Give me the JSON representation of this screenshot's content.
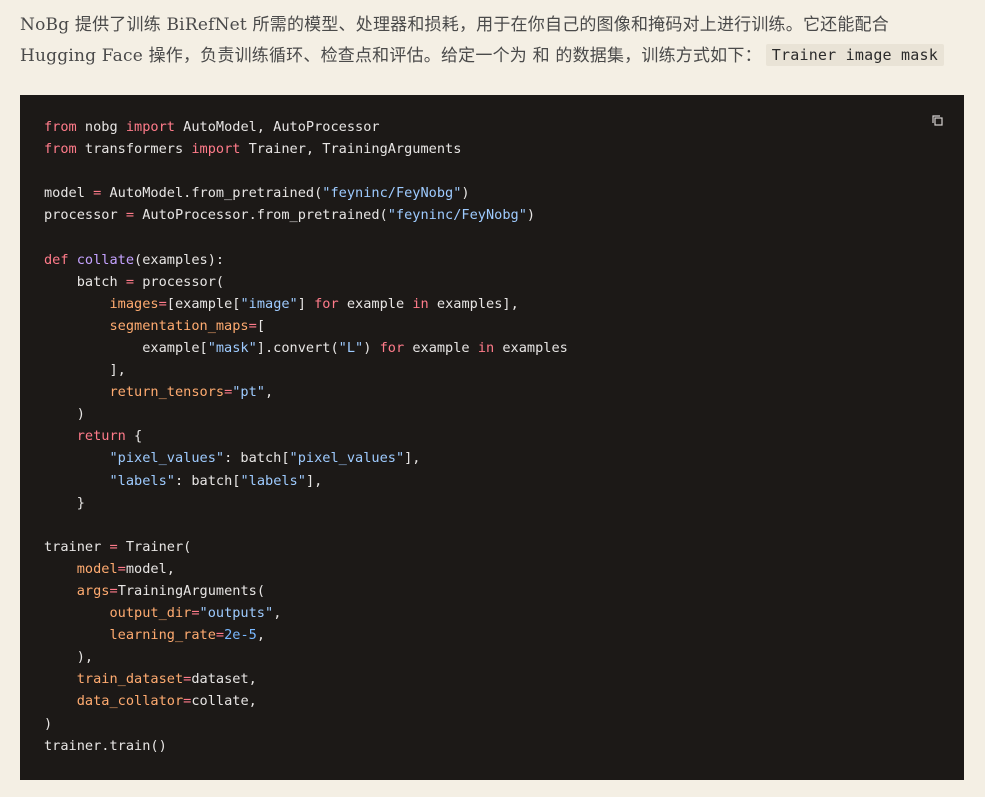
{
  "intro": {
    "line1": "NoBg 提供了训练 BiRefNet 所需的模型、处理器和损耗，用于在你自己的图像和掩码对上进行训练。它还能配合",
    "line2": "Hugging Face 操作，负责训练循环、检查点和评估。给定一个为 和 的数据集，训练方式如下：",
    "inline_code": "Trainer image mask"
  },
  "code_block": {
    "language": "python",
    "copy_icon": "copy-icon",
    "lines": [
      [
        [
          "kw",
          "from"
        ],
        [
          "plain",
          " nobg "
        ],
        [
          "kw",
          "import"
        ],
        [
          "plain",
          " AutoModel, AutoProcessor"
        ]
      ],
      [
        [
          "kw",
          "from"
        ],
        [
          "plain",
          " transformers "
        ],
        [
          "kw",
          "import"
        ],
        [
          "plain",
          " Trainer, TrainingArguments"
        ]
      ],
      [],
      [
        [
          "plain",
          "model "
        ],
        [
          "op",
          "="
        ],
        [
          "plain",
          " AutoModel.from_pretrained("
        ],
        [
          "str",
          "\"feyninc/FeyNobg\""
        ],
        [
          "plain",
          ")"
        ]
      ],
      [
        [
          "plain",
          "processor "
        ],
        [
          "op",
          "="
        ],
        [
          "plain",
          " AutoProcessor.from_pretrained("
        ],
        [
          "str",
          "\"feyninc/FeyNobg\""
        ],
        [
          "plain",
          ")"
        ]
      ],
      [],
      [
        [
          "kw",
          "def"
        ],
        [
          "plain",
          " "
        ],
        [
          "fn",
          "collate"
        ],
        [
          "plain",
          "(examples):"
        ]
      ],
      [
        [
          "plain",
          "    batch "
        ],
        [
          "op",
          "="
        ],
        [
          "plain",
          " processor("
        ]
      ],
      [
        [
          "plain",
          "        "
        ],
        [
          "param",
          "images"
        ],
        [
          "op",
          "="
        ],
        [
          "plain",
          "[example["
        ],
        [
          "str",
          "\"image\""
        ],
        [
          "plain",
          "] "
        ],
        [
          "kw",
          "for"
        ],
        [
          "plain",
          " example "
        ],
        [
          "kw",
          "in"
        ],
        [
          "plain",
          " examples],"
        ]
      ],
      [
        [
          "plain",
          "        "
        ],
        [
          "param",
          "segmentation_maps"
        ],
        [
          "op",
          "="
        ],
        [
          "plain",
          "["
        ]
      ],
      [
        [
          "plain",
          "            example["
        ],
        [
          "str",
          "\"mask\""
        ],
        [
          "plain",
          "].convert("
        ],
        [
          "str",
          "\"L\""
        ],
        [
          "plain",
          ") "
        ],
        [
          "kw",
          "for"
        ],
        [
          "plain",
          " example "
        ],
        [
          "kw",
          "in"
        ],
        [
          "plain",
          " examples"
        ]
      ],
      [
        [
          "plain",
          "        ],"
        ]
      ],
      [
        [
          "plain",
          "        "
        ],
        [
          "param",
          "return_tensors"
        ],
        [
          "op",
          "="
        ],
        [
          "str",
          "\"pt\""
        ],
        [
          "plain",
          ","
        ]
      ],
      [
        [
          "plain",
          "    )"
        ]
      ],
      [
        [
          "plain",
          "    "
        ],
        [
          "kw",
          "return"
        ],
        [
          "plain",
          " {"
        ]
      ],
      [
        [
          "plain",
          "        "
        ],
        [
          "str",
          "\"pixel_values\""
        ],
        [
          "plain",
          ": batch["
        ],
        [
          "str",
          "\"pixel_values\""
        ],
        [
          "plain",
          "],"
        ]
      ],
      [
        [
          "plain",
          "        "
        ],
        [
          "str",
          "\"labels\""
        ],
        [
          "plain",
          ": batch["
        ],
        [
          "str",
          "\"labels\""
        ],
        [
          "plain",
          "],"
        ]
      ],
      [
        [
          "plain",
          "    }"
        ]
      ],
      [],
      [
        [
          "plain",
          "trainer "
        ],
        [
          "op",
          "="
        ],
        [
          "plain",
          " Trainer("
        ]
      ],
      [
        [
          "plain",
          "    "
        ],
        [
          "param",
          "model"
        ],
        [
          "op",
          "="
        ],
        [
          "plain",
          "model,"
        ]
      ],
      [
        [
          "plain",
          "    "
        ],
        [
          "param",
          "args"
        ],
        [
          "op",
          "="
        ],
        [
          "plain",
          "TrainingArguments("
        ]
      ],
      [
        [
          "plain",
          "        "
        ],
        [
          "param",
          "output_dir"
        ],
        [
          "op",
          "="
        ],
        [
          "str",
          "\"outputs\""
        ],
        [
          "plain",
          ","
        ]
      ],
      [
        [
          "plain",
          "        "
        ],
        [
          "param",
          "learning_rate"
        ],
        [
          "op",
          "="
        ],
        [
          "num",
          "2e-5"
        ],
        [
          "plain",
          ","
        ]
      ],
      [
        [
          "plain",
          "    ),"
        ]
      ],
      [
        [
          "plain",
          "    "
        ],
        [
          "param",
          "train_dataset"
        ],
        [
          "op",
          "="
        ],
        [
          "plain",
          "dataset,"
        ]
      ],
      [
        [
          "plain",
          "    "
        ],
        [
          "param",
          "data_collator"
        ],
        [
          "op",
          "="
        ],
        [
          "plain",
          "collate,"
        ]
      ],
      [
        [
          "plain",
          ")"
        ]
      ],
      [
        [
          "plain",
          "trainer.train()"
        ]
      ]
    ]
  }
}
